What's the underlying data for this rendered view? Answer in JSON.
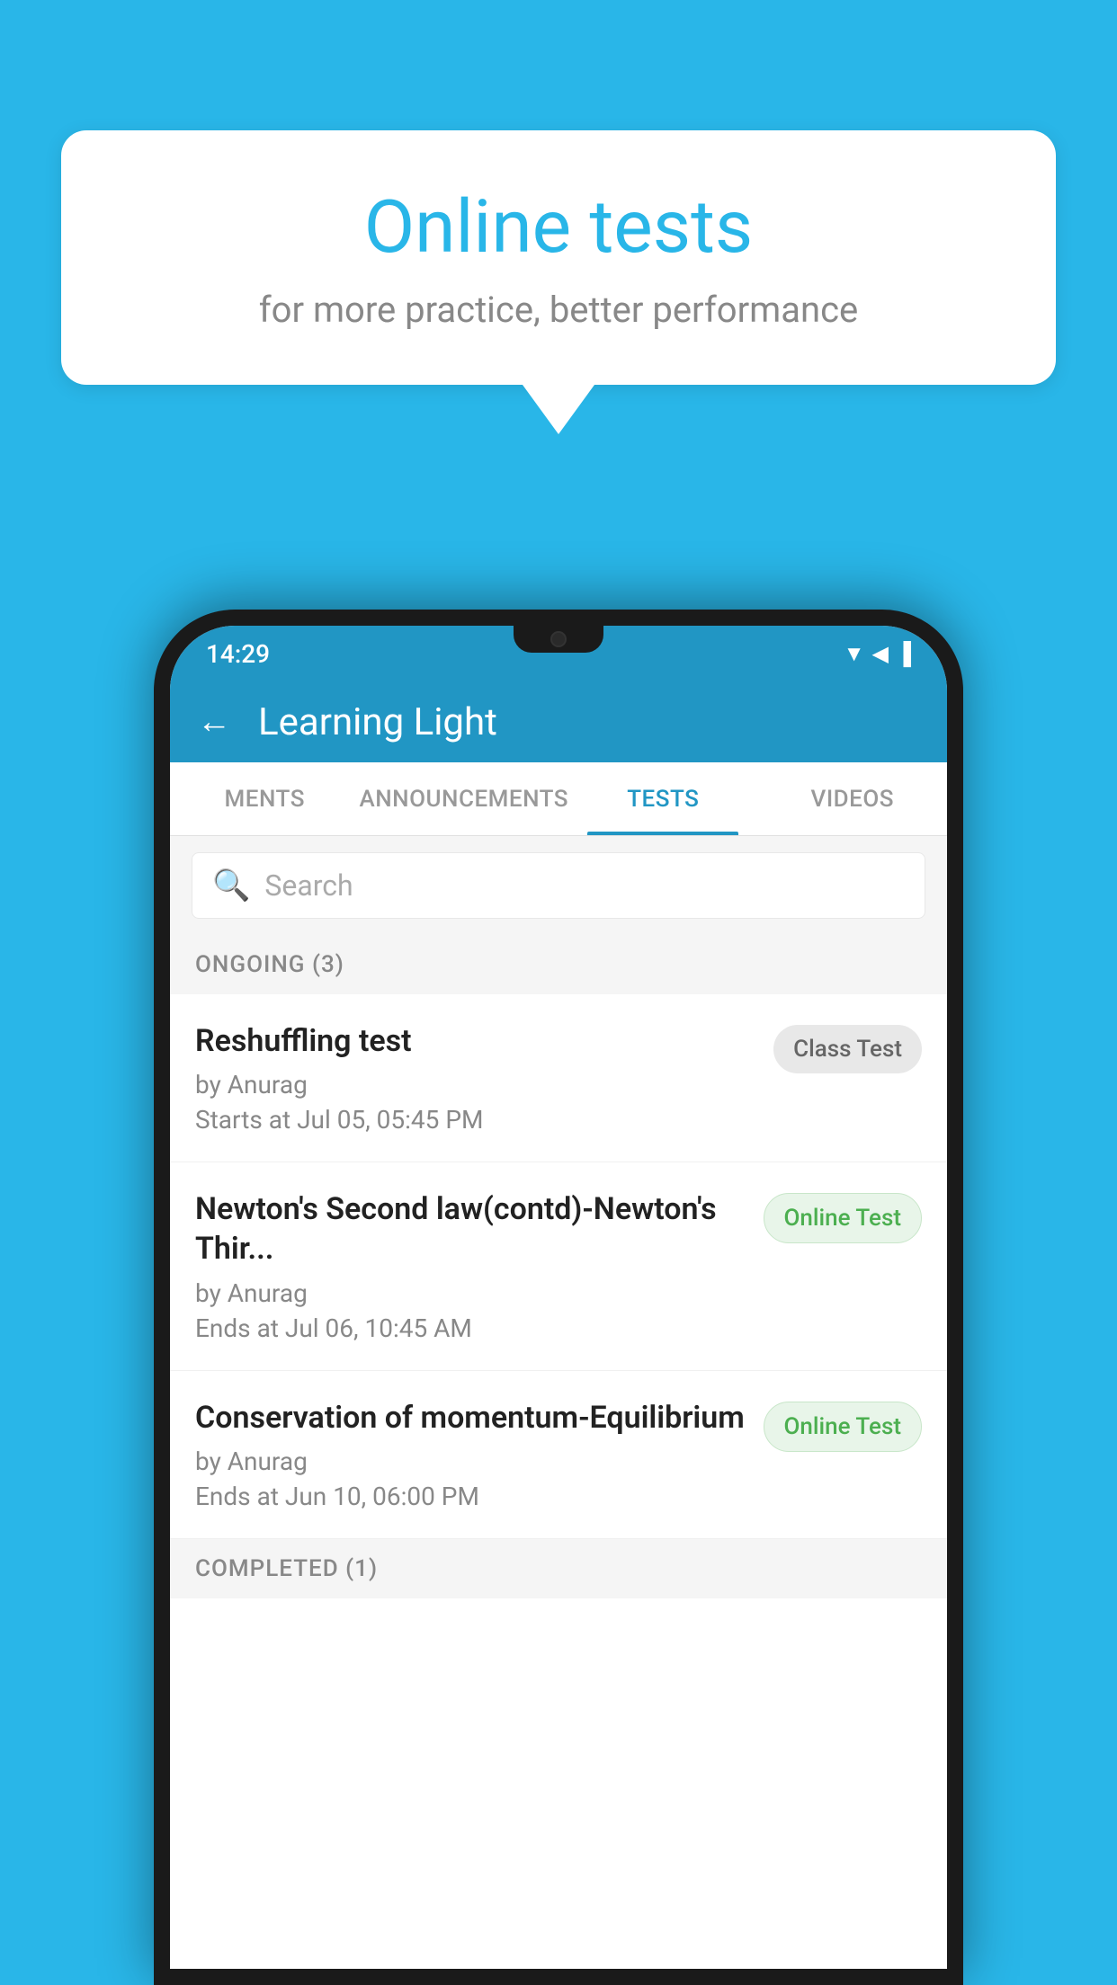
{
  "background": {
    "color": "#29b6e8"
  },
  "speech_bubble": {
    "title": "Online tests",
    "subtitle": "for more practice, better performance"
  },
  "phone": {
    "status_bar": {
      "time": "14:29",
      "icons": "▼◀▐"
    },
    "app_header": {
      "back_label": "←",
      "title": "Learning Light"
    },
    "tabs": [
      {
        "label": "MENTS",
        "active": false
      },
      {
        "label": "ANNOUNCEMENTS",
        "active": false
      },
      {
        "label": "TESTS",
        "active": true
      },
      {
        "label": "VIDEOS",
        "active": false
      }
    ],
    "search": {
      "placeholder": "Search"
    },
    "sections": [
      {
        "header": "ONGOING (3)",
        "items": [
          {
            "name": "Reshuffling test",
            "author": "by Anurag",
            "date": "Starts at  Jul 05, 05:45 PM",
            "badge": "Class Test",
            "badge_type": "class"
          },
          {
            "name": "Newton's Second law(contd)-Newton's Thir...",
            "author": "by Anurag",
            "date": "Ends at  Jul 06, 10:45 AM",
            "badge": "Online Test",
            "badge_type": "online"
          },
          {
            "name": "Conservation of momentum-Equilibrium",
            "author": "by Anurag",
            "date": "Ends at  Jun 10, 06:00 PM",
            "badge": "Online Test",
            "badge_type": "online"
          }
        ]
      }
    ],
    "completed_header": "COMPLETED (1)"
  }
}
